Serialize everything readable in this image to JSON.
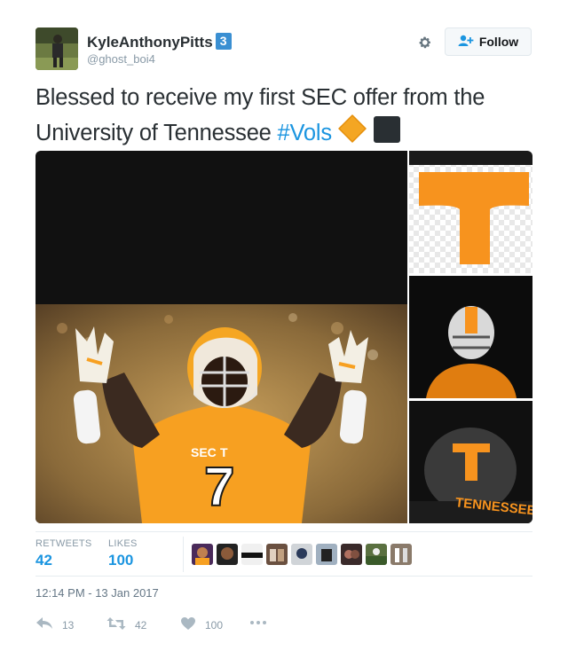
{
  "user": {
    "display_name": "KyleAnthonyPitts",
    "badge_count": "3",
    "handle": "@ghost_boi4"
  },
  "header": {
    "follow_label": "Follow",
    "settings_icon": "gear-icon",
    "follow_icon": "add-user-icon"
  },
  "tweet": {
    "text_line1": "Blessed to receive my first SEC offer from the",
    "text_line2": "University of Tennessee",
    "hashtag": "#Vols"
  },
  "media": {
    "jersey_number": "7",
    "side_text": "TENNESSEE"
  },
  "stats": {
    "retweets_label": "RETWEETS",
    "retweets_value": "42",
    "likes_label": "LIKES",
    "likes_value": "100"
  },
  "timestamp": "12:14 PM - 13 Jan 2017",
  "actions": {
    "reply_count": "13",
    "retweet_count": "42",
    "like_count": "100"
  },
  "colors": {
    "link": "#1b95e0",
    "tennessee_orange": "#f7931e",
    "muted": "#8899a6"
  }
}
